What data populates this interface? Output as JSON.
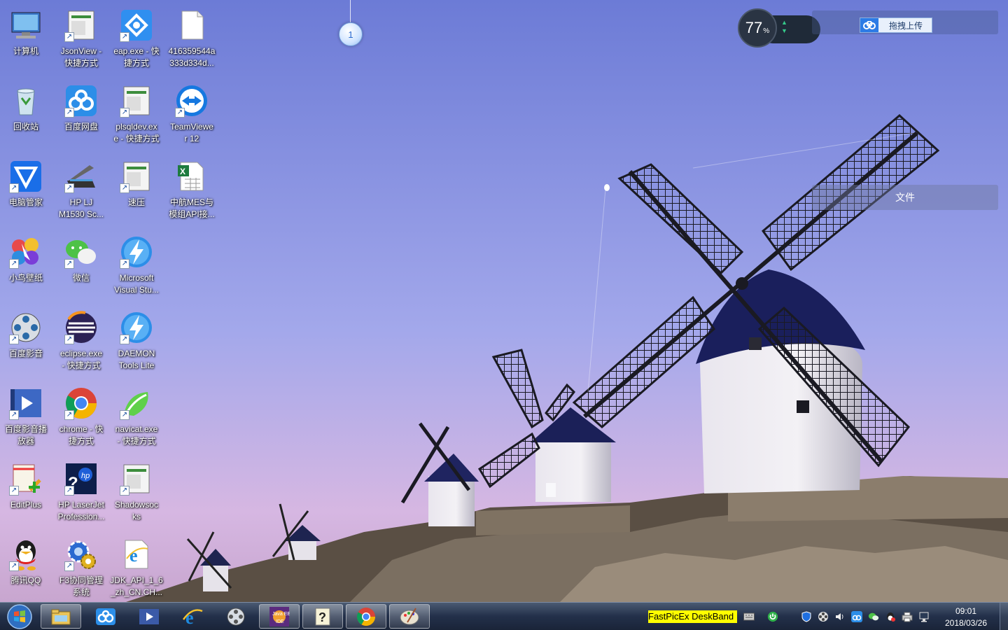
{
  "desktop": {
    "icons": [
      {
        "label": "计算机"
      },
      {
        "label": "JsonView -\n快捷方式"
      },
      {
        "label": "eap.exe - 快\n捷方式"
      },
      {
        "label": "416359544a\n333d334d..."
      },
      {
        "label": "回收站"
      },
      {
        "label": "百度网盘"
      },
      {
        "label": "plsqldev.ex\ne - 快捷方式"
      },
      {
        "label": "TeamViewe\nr 12"
      },
      {
        "label": "电脑管家"
      },
      {
        "label": "HP LJ\nM1530 Sc..."
      },
      {
        "label": "速压"
      },
      {
        "label": "中航MES与\n模组API接..."
      },
      {
        "label": "小鸟壁纸"
      },
      {
        "label": "微信"
      },
      {
        "label": "Microsoft\nVisual Stu..."
      },
      {
        "label": "百度影音"
      },
      {
        "label": "eclipse.exe\n- 快捷方式"
      },
      {
        "label": "DAEMON\nTools Lite"
      },
      {
        "label": "百度影音播\n放器"
      },
      {
        "label": "chrome - 快\n捷方式"
      },
      {
        "label": "navicat.exe\n- 快捷方式"
      },
      {
        "label": "EditPlus"
      },
      {
        "label": "HP LaserJet\nProfession..."
      },
      {
        "label": "Shadowsoc\nks"
      },
      {
        "label": "腾讯QQ"
      },
      {
        "label": "F3协同管理\n系统"
      },
      {
        "label": "JDK_API_1_6\n_zh_CN.CH..."
      }
    ]
  },
  "widgets": {
    "float_ball_label": "1",
    "speed_percent": "77",
    "speed_unit": "%",
    "upload_label": "拖拽上传",
    "file_panel_label": "文件"
  },
  "taskbar": {
    "deskband_text": "FastPicEx DeskBand",
    "time": "09:01",
    "date": "2018/03/26"
  },
  "colors": {
    "sky_top": "#7d86dc",
    "sky_bottom": "#d9b8de",
    "taskbar": "#23304a",
    "deskband": "#ffff00"
  }
}
